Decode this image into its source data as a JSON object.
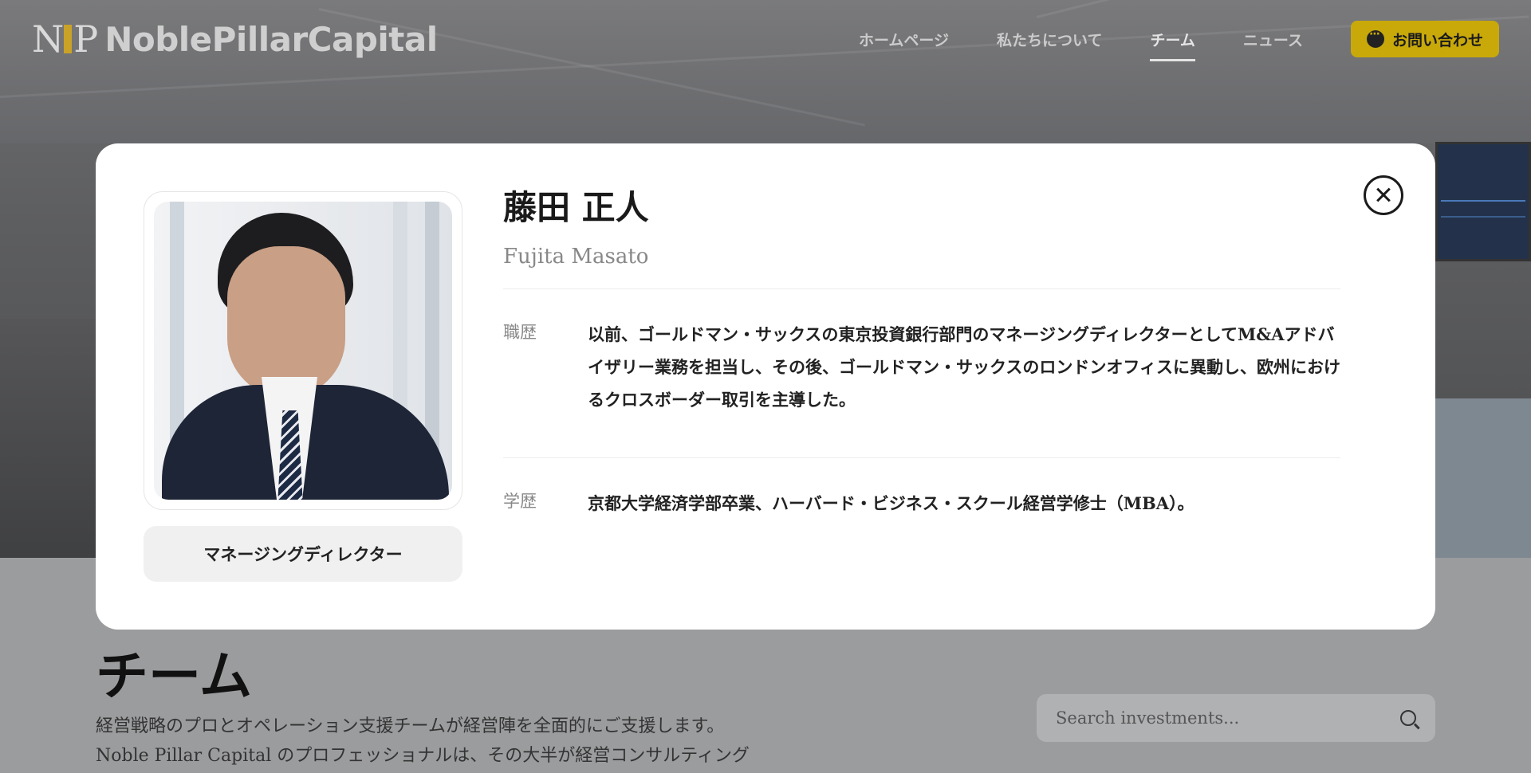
{
  "header": {
    "logo_mark": "NP",
    "logo_text": "NoblePillarCapital",
    "nav": [
      {
        "label": "ホームページ",
        "active": false
      },
      {
        "label": "私たちについて",
        "active": false
      },
      {
        "label": "チーム",
        "active": true
      },
      {
        "label": "ニュース",
        "active": false
      }
    ],
    "contact_label": "お問い合わせ"
  },
  "page": {
    "title": "チーム",
    "description_line1": "経営戦略のプロとオペレーション支援チームが経営陣を全面的にご支援します。",
    "description_line2": "Noble Pillar Capital のプロフェッショナルは、その大半が経営コンサルティング",
    "search_placeholder": "Search investments..."
  },
  "modal": {
    "name_jp": "藤田 正人",
    "name_en": "Fujita Masato",
    "role": "マネージングディレクター",
    "career_label": "職歴",
    "career_text": "以前、ゴールドマン・サックスの東京投資銀行部門のマネージングディレクターとしてM&Aアドバイザリー業務を担当し、その後、ゴールドマン・サックスのロンドンオフィスに異動し、欧州におけるクロスボーダー取引を主導した。",
    "education_label": "学歴",
    "education_text": "京都大学経済学部卒業、ハーバード・ビジネス・スクール経営学修士（MBA）。"
  },
  "colors": {
    "accent": "#c9a90a",
    "overlay": "#9b9c9e",
    "modal_bg": "#ffffff"
  }
}
